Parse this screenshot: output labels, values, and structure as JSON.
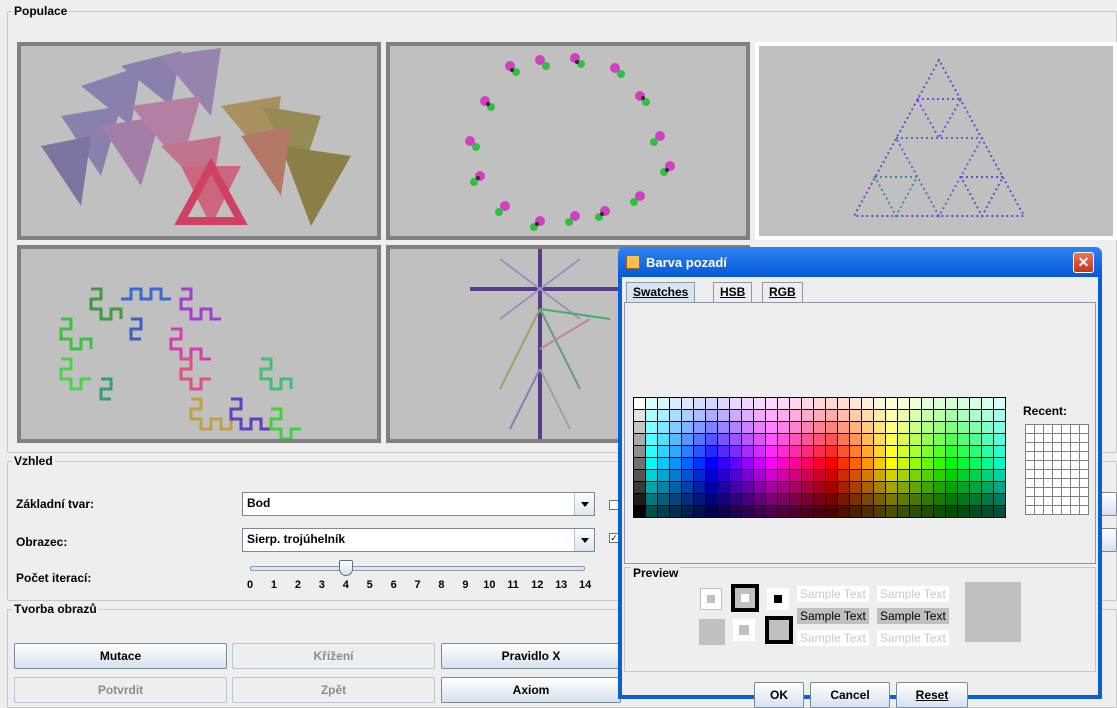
{
  "population": {
    "title": "Populace",
    "tiles": [
      {
        "name": "tile-triangle-tree",
        "selected": false
      },
      {
        "name": "tile-flower-ring",
        "selected": false
      },
      {
        "name": "tile-sierpinski",
        "selected": true
      },
      {
        "name": "tile-dragon-curve",
        "selected": false
      },
      {
        "name": "tile-cross-plant",
        "selected": false
      }
    ]
  },
  "appearance": {
    "title": "Vzhled",
    "base_shape_label": "Základní tvar:",
    "base_shape_value": "Bod",
    "pattern_label": "Obrazec:",
    "pattern_value": "Sierp. trojúhelník",
    "iterations_label": "Počet iterací:",
    "iterations_value": 4,
    "iterations_ticks": [
      "0",
      "1",
      "2",
      "3",
      "4",
      "5",
      "6",
      "7",
      "8",
      "9",
      "10",
      "11",
      "12",
      "13",
      "14"
    ]
  },
  "creation": {
    "title": "Tvorba obrazů",
    "buttons": {
      "mutation": "Mutace",
      "crossover": "Křížení",
      "rule_x": "Pravidlo X",
      "confirm": "Potvrdit",
      "back": "Zpět",
      "axiom": "Axiom"
    }
  },
  "dialog": {
    "title": "Barva pozadí",
    "tabs": [
      "Swatches",
      "HSB",
      "RGB"
    ],
    "active_tab": "Swatches",
    "recent_label": "Recent:",
    "preview_label": "Preview",
    "sample_text": "Sample Text",
    "ok": "OK",
    "cancel": "Cancel",
    "reset": "Reset",
    "preview_color": "#c0c0c0"
  }
}
